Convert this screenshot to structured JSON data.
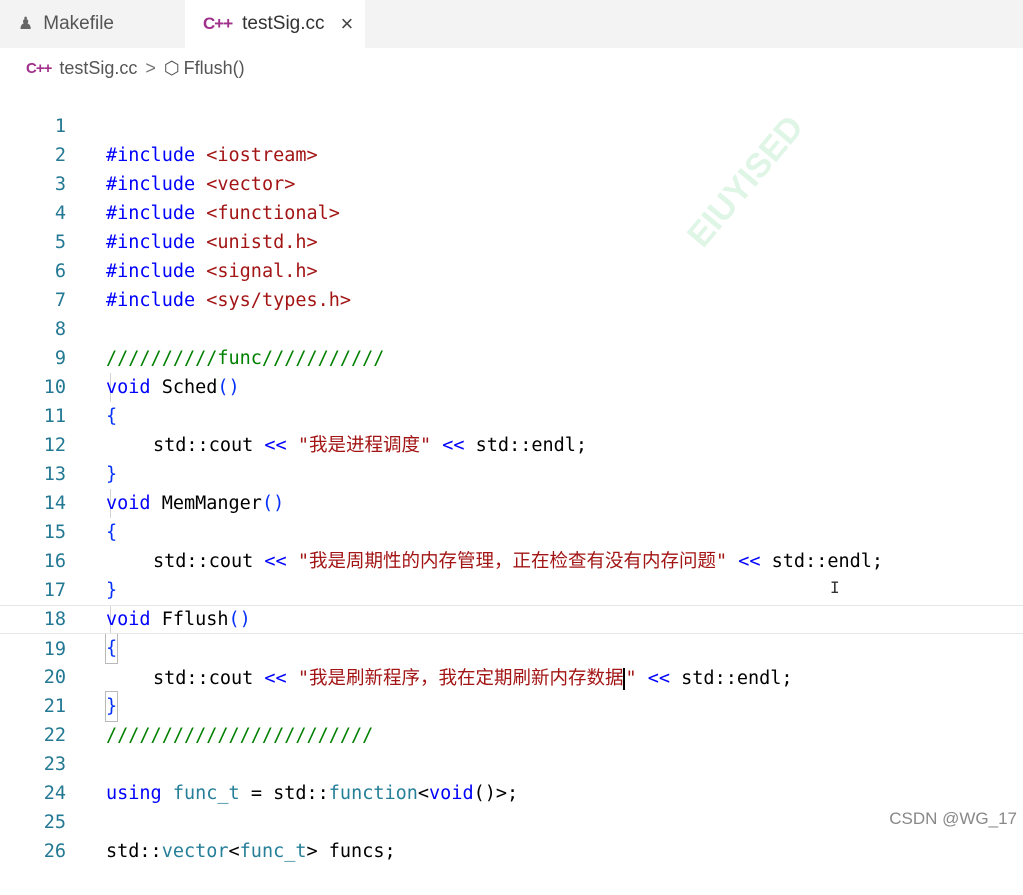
{
  "tabs": [
    {
      "label": "Makefile",
      "icon": "makefile-icon"
    },
    {
      "label": "testSig.cc",
      "icon": "cpp-file-icon",
      "close": "×"
    }
  ],
  "cpp_icon_text": "C++",
  "breadcrumb": {
    "file": "testSig.cc",
    "separator": ">",
    "symbol": "Fflush()"
  },
  "watermark": "EIUYISED",
  "footer_credit": "CSDN @WG_17",
  "current_line": 19,
  "lines": [
    {
      "n": "1"
    },
    {
      "n": "2"
    },
    {
      "n": "3"
    },
    {
      "n": "4"
    },
    {
      "n": "5"
    },
    {
      "n": "6"
    },
    {
      "n": "7"
    },
    {
      "n": "8"
    },
    {
      "n": "9"
    },
    {
      "n": "10"
    },
    {
      "n": "11"
    },
    {
      "n": "12"
    },
    {
      "n": "13"
    },
    {
      "n": "14"
    },
    {
      "n": "15"
    },
    {
      "n": "16"
    },
    {
      "n": "17"
    },
    {
      "n": "18"
    },
    {
      "n": "19"
    },
    {
      "n": "20"
    },
    {
      "n": "21"
    },
    {
      "n": "22"
    },
    {
      "n": "23"
    },
    {
      "n": "24"
    },
    {
      "n": "25"
    },
    {
      "n": "26"
    }
  ],
  "code": {
    "l1": [
      "#include",
      "<iostream>"
    ],
    "l2": [
      "#include",
      "<vector>"
    ],
    "l3": [
      "#include",
      "<functional>"
    ],
    "l4": [
      "#include",
      "<unistd.h>"
    ],
    "l5": [
      "#include",
      "<signal.h>"
    ],
    "l6": [
      "#include",
      "<sys/types.h>"
    ],
    "l8": "//////////func///////////",
    "l9": [
      "void",
      "Sched",
      "()"
    ],
    "l10": "{",
    "l11": [
      "std::cout",
      "<<",
      "\"我是进程调度\"",
      "<<",
      "std::endl;"
    ],
    "l12": "}",
    "l13": [
      "void",
      "MemManger",
      "()"
    ],
    "l14": "{",
    "l15": [
      "std::cout",
      "<<",
      "\"我是周期性的内存管理，正在检查有没有内存问题\"",
      "<<",
      "std::endl;"
    ],
    "l16": "}",
    "l17": [
      "void",
      "Fflush",
      "()"
    ],
    "l18": "{",
    "l19": [
      "std::cout",
      "<<",
      "\"我是刷新程序，我在定期刷新内存数据",
      "\"",
      "<<",
      "std::endl;"
    ],
    "l20": "}",
    "l21": "////////////////////////",
    "l23": [
      "using",
      "func_t",
      "=",
      "std::",
      "function",
      "<",
      "void",
      "()>;"
    ],
    "l25": [
      "std::",
      "vector",
      "<",
      "func_t",
      ">",
      "funcs;"
    ]
  },
  "colors": {
    "keyword": "#0000ff",
    "string": "#a31515",
    "comment": "#008000",
    "type": "#267f99",
    "line_number": "#237893"
  }
}
